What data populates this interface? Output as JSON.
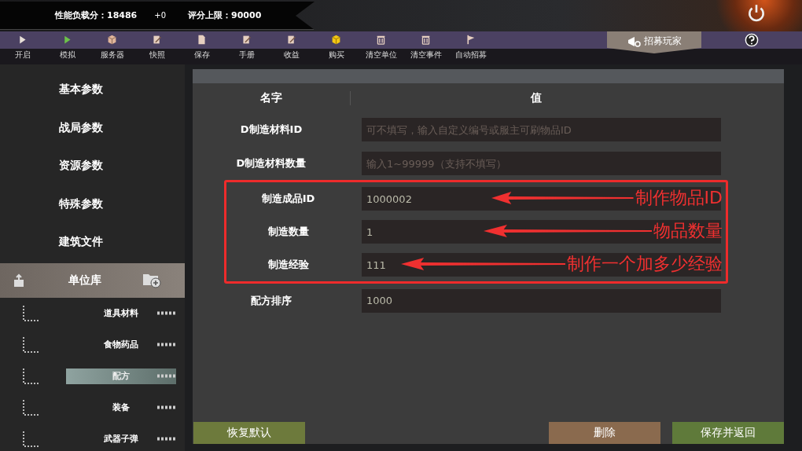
{
  "status_banner": {
    "load_score": "性能负载分：18486",
    "delta": "+0",
    "score_limit": "评分上限：90000"
  },
  "toolbar": [
    {
      "label": "开启",
      "kind": "play"
    },
    {
      "label": "模拟",
      "kind": "simulate"
    },
    {
      "label": "服务器",
      "kind": "server"
    },
    {
      "label": "快照",
      "kind": "edit"
    },
    {
      "label": "保存",
      "kind": "save"
    },
    {
      "label": "手册",
      "kind": "edit"
    },
    {
      "label": "收益",
      "kind": "edit"
    },
    {
      "label": "购买",
      "kind": "buy"
    },
    {
      "label": "清空单位",
      "kind": "clear"
    },
    {
      "label": "清空事件",
      "kind": "clear"
    },
    {
      "label": "自动招募",
      "kind": "recruit"
    }
  ],
  "recruit_tab": {
    "label": "招募玩家"
  },
  "sidebar": {
    "items": [
      {
        "label": "基本参数"
      },
      {
        "label": "战局参数"
      },
      {
        "label": "资源参数"
      },
      {
        "label": "特殊参数"
      },
      {
        "label": "建筑文件"
      }
    ],
    "library": {
      "label": "单位库",
      "children": [
        {
          "label": "道具材料",
          "selected": false
        },
        {
          "label": "食物药品",
          "selected": false
        },
        {
          "label": "配方",
          "selected": true
        },
        {
          "label": "装备",
          "selected": false
        },
        {
          "label": "武器子弹",
          "selected": false
        }
      ]
    }
  },
  "table": {
    "columns": [
      "名字",
      "值"
    ],
    "rows": [
      {
        "name": "D制造材料ID",
        "placeholder": "可不填写，输入自定义编号或服主可刷物品ID",
        "highlighted": false
      },
      {
        "name": "D制造材料数量",
        "placeholder": "输入1~99999（支持不填写）",
        "highlighted": false
      },
      {
        "name": "制造成品ID",
        "value": "1000002",
        "highlighted": true,
        "annotation": "制作物品ID"
      },
      {
        "name": "制造数量",
        "value": "1",
        "highlighted": true,
        "annotation": "物品数量"
      },
      {
        "name": "制造经验",
        "value": "111",
        "highlighted": true,
        "annotation": "制作一个加多少经验"
      },
      {
        "name": "配方排序",
        "value": "1000",
        "highlighted": false
      }
    ]
  },
  "buttons": [
    {
      "label": "恢复默认",
      "kind": "reset"
    },
    {
      "label": "删除",
      "kind": "delete"
    },
    {
      "label": "保存并返回",
      "kind": "save"
    }
  ]
}
